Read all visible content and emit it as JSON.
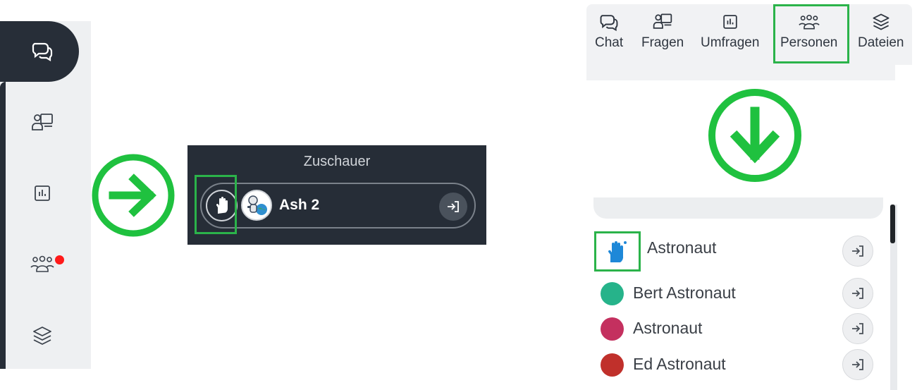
{
  "sidebar": {
    "items": [
      {
        "icon": "chat-icon",
        "active": true
      },
      {
        "icon": "questions-icon",
        "active": false
      },
      {
        "icon": "polls-icon",
        "active": false
      },
      {
        "icon": "people-icon",
        "active": false,
        "has_notification": true
      },
      {
        "icon": "files-icon",
        "active": false
      }
    ]
  },
  "viewer_panel": {
    "title": "Zuschauer",
    "user": {
      "name": "Ash 2",
      "hand_raised": true
    }
  },
  "tabs": [
    {
      "label": "Chat",
      "icon": "chat-icon"
    },
    {
      "label": "Fragen",
      "icon": "questions-icon"
    },
    {
      "label": "Umfragen",
      "icon": "polls-icon"
    },
    {
      "label": "Personen",
      "icon": "people-icon",
      "highlighted": true
    },
    {
      "label": "Dateien",
      "icon": "files-icon"
    }
  ],
  "people_list": [
    {
      "name": "Astronaut",
      "hand_raised": true
    },
    {
      "name": "Bert Astronaut",
      "color": "#26b38a"
    },
    {
      "name": "Astronaut",
      "color": "#c4305f"
    },
    {
      "name": "Ed Astronaut",
      "color": "#c0302b"
    }
  ],
  "colors": {
    "highlight_green": "#2bb34a",
    "arrow_green": "#1fc13f",
    "dark_panel": "#262d37",
    "hand_blue": "#1e88d8",
    "notification_red": "#ff1a1a"
  }
}
